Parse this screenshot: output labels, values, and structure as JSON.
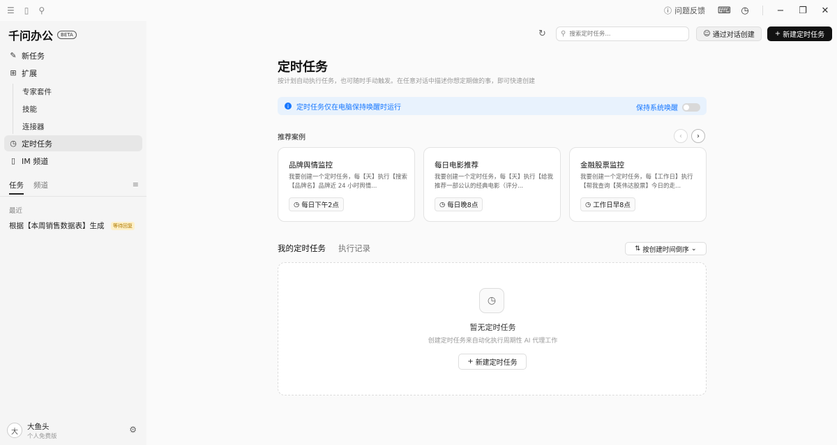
{
  "titlebar": {
    "feedback_label": "问题反馈"
  },
  "sidebar": {
    "brand": "千问办公",
    "beta": "BETA",
    "new_task": "新任务",
    "extensions": "扩展",
    "sub_items": [
      "专家套件",
      "技能",
      "连接器"
    ],
    "scheduled_tasks": "定时任务",
    "im_channels": "IM 频道",
    "tabs": [
      "任务",
      "频道"
    ],
    "recent_label": "最近",
    "recent_item": "根据【本周销售数据表】生成",
    "recent_badge": "等待回复",
    "user": {
      "avatar_initial": "大",
      "name": "大鱼头",
      "plan": "个人免费版"
    }
  },
  "topbar": {
    "search_placeholder": "搜索定时任务...",
    "create_via_chat": "通过对话创建",
    "new_scheduled_task": "新建定时任务"
  },
  "main": {
    "title": "定时任务",
    "description": "按计划自动执行任务，也可随时手动触发。在任意对话中描述你想定期做的事，即可快速创建",
    "info_text": "定时任务仅在电脑保持唤醒时运行",
    "keep_awake_label": "保持系统唤醒",
    "recommended_label": "推荐案例",
    "cards": [
      {
        "title": "品牌舆情监控",
        "desc": "我要创建一个定时任务，每【天】执行【搜索【品牌名】品牌近 24 小时舆情...",
        "schedule": "每日下午2点"
      },
      {
        "title": "每日电影推荐",
        "desc": "我要创建一个定时任务，每【天】执行【给我推荐一部公认的经典电影（评分...",
        "schedule": "每日晚8点"
      },
      {
        "title": "金融股票监控",
        "desc": "我要创建一个定时任务，每【工作日】执行【帮我查询【英伟达股票】今日的走...",
        "schedule": "工作日早8点"
      }
    ],
    "tabs": [
      "我的定时任务",
      "执行记录"
    ],
    "sort_label": "按创建时间倒序",
    "empty": {
      "title": "暂无定时任务",
      "desc": "创建定时任务来自动化执行周期性 AI 代理工作",
      "button": "新建定时任务"
    }
  },
  "colors": {
    "accent": "#1677ff",
    "info_bg": "#e8f2fd",
    "badge_bg": "#fdf0c9",
    "primary_button": "#111111"
  }
}
